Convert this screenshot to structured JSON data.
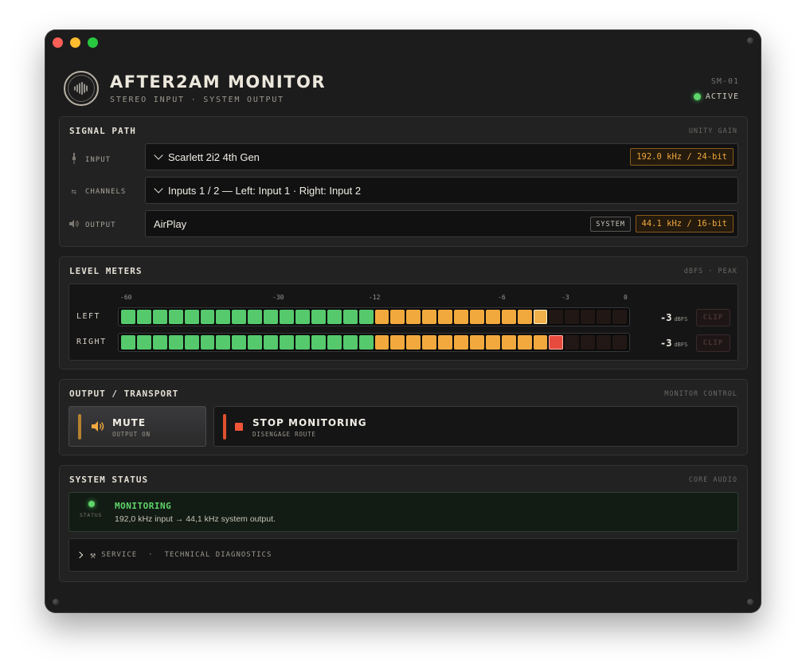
{
  "window": {
    "app_title": "AFTER2AM MONITOR",
    "app_subtitle": "STEREO INPUT · SYSTEM OUTPUT",
    "model": "SM-01",
    "state": "ACTIVE"
  },
  "signal_path": {
    "title": "SIGNAL PATH",
    "tag": "UNITY GAIN",
    "input": {
      "label": "INPUT",
      "value": "Scarlett 2i2 4th Gen",
      "rate": "192.0 kHz / 24-bit"
    },
    "channels": {
      "label": "CHANNELS",
      "value": "Inputs 1 / 2 — Left: Input 1 · Right: Input 2"
    },
    "output": {
      "label": "OUTPUT",
      "value": "AirPlay",
      "badge": "SYSTEM",
      "rate": "44.1 kHz / 16-bit"
    }
  },
  "level_meters": {
    "title": "LEVEL METERS",
    "tag": "dBFS · PEAK",
    "scale": [
      "-60",
      "-30",
      "-12",
      "-6",
      "-3",
      "0"
    ],
    "channels": [
      {
        "label": "LEFT",
        "readout": "-3",
        "unit": "dBFS",
        "clip": "CLIP",
        "lit_segments": 27,
        "peak_segment": 27,
        "peak_color": "amber"
      },
      {
        "label": "RIGHT",
        "readout": "-3",
        "unit": "dBFS",
        "clip": "CLIP",
        "lit_segments": 28,
        "peak_segment": 28,
        "peak_color": "red"
      }
    ],
    "segment_count": 32
  },
  "transport": {
    "title": "OUTPUT / TRANSPORT",
    "tag": "MONITOR CONTROL",
    "mute": {
      "title": "MUTE",
      "sub": "OUTPUT ON"
    },
    "stop": {
      "title": "STOP MONITORING",
      "sub": "DISENGAGE ROUTE"
    }
  },
  "system_status": {
    "title": "SYSTEM STATUS",
    "tag": "CORE AUDIO",
    "led_label": "STATUS",
    "status": "MONITORING",
    "detail": "192,0 kHz input → 44,1 kHz system output.",
    "service": "SERVICE",
    "separator": "·",
    "diagnostics": "TECHNICAL DIAGNOSTICS"
  },
  "colors": {
    "green": "#55c96c",
    "amber": "#f1a93e",
    "red": "#e74b3e",
    "status_green": "#5fd46a"
  }
}
